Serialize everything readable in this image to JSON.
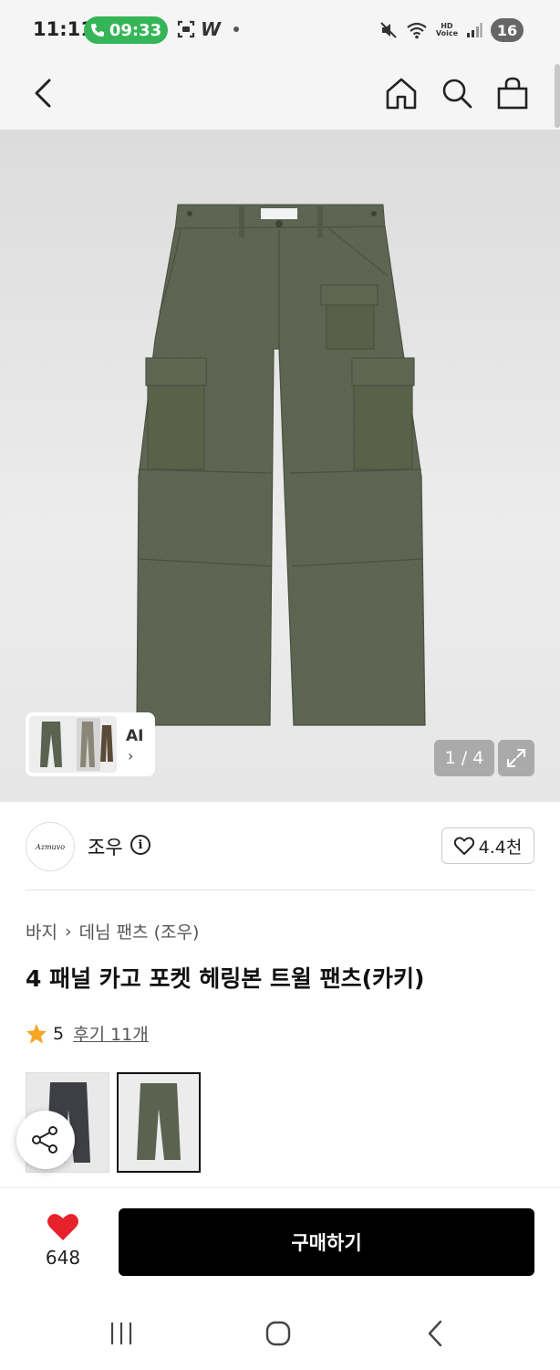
{
  "status_bar": {
    "time": "11:11",
    "call_timer": "09:33",
    "app_indicator": "W",
    "battery": "16",
    "hd_label": "HD",
    "voice_label": "Voice"
  },
  "nav": {
    "icons": [
      "back-icon",
      "home-icon",
      "search-icon",
      "shopping-bag-icon"
    ]
  },
  "gallery": {
    "ai_label": "AI",
    "ai_chevron": "›",
    "pager": "1 / 4"
  },
  "brand": {
    "name": "조우",
    "info_glyph": "i",
    "logo_text": "Azmuvo",
    "likes": "4.4천"
  },
  "product": {
    "breadcrumb": [
      "바지",
      "데님 팬츠 (조우)"
    ],
    "breadcrumb_sep": "›",
    "title": "4 패널 카고 포켓 헤링본 트윌 팬츠(카키)",
    "rating": "5",
    "reviews": "후기 11개",
    "variants": [
      "charcoal",
      "khaki"
    ]
  },
  "bottom": {
    "wish_count": "648",
    "buy_label": "구매하기"
  },
  "colors": {
    "accent_call": "#35b557",
    "heart": "#e8222d",
    "star": "#f5a623",
    "pants": "#5b6350",
    "buy_button": "#000000"
  }
}
